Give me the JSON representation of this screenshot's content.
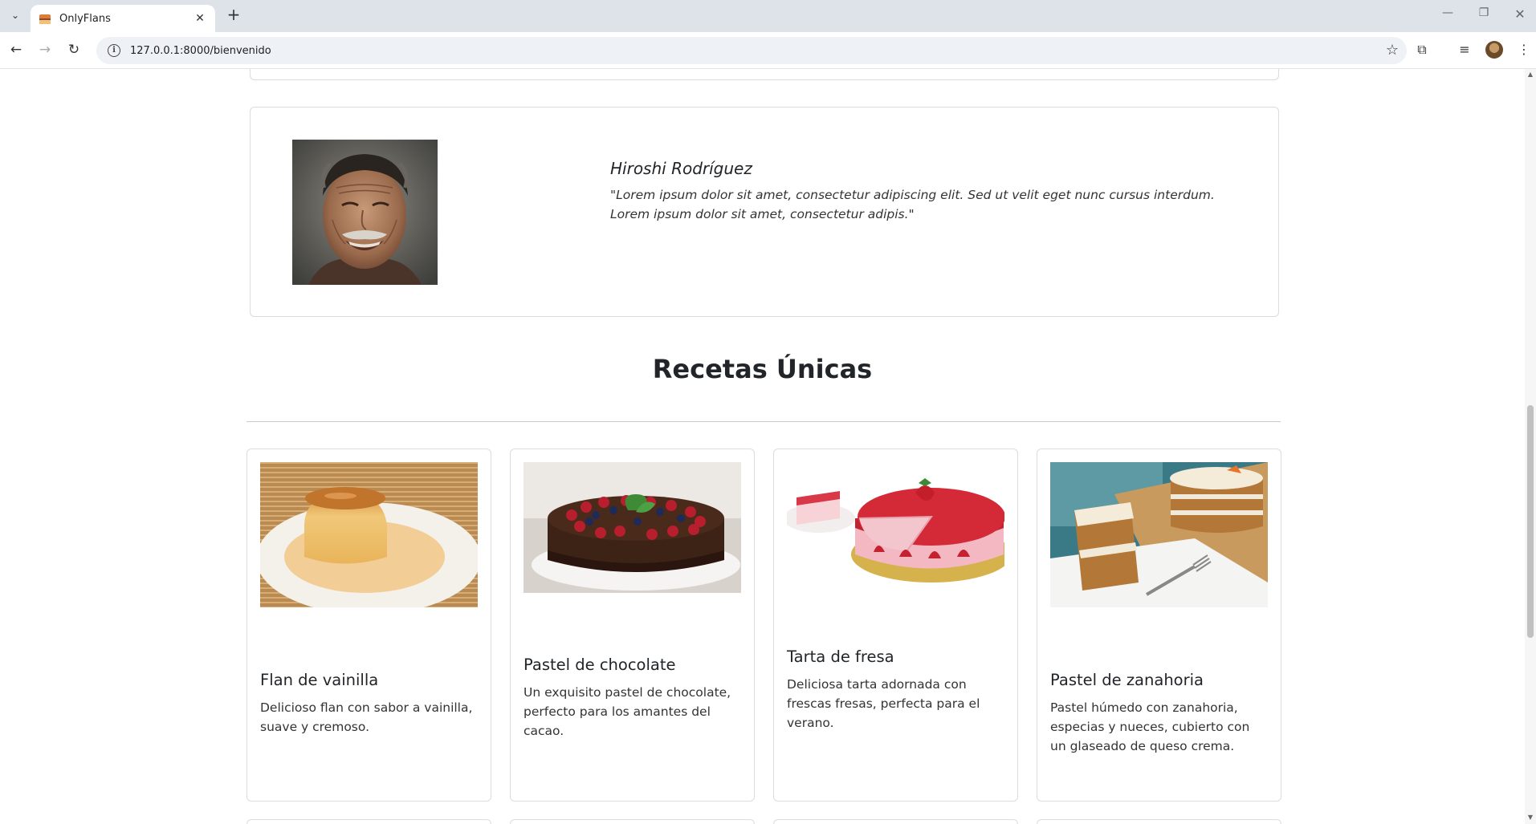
{
  "browser": {
    "tab_title": "OnlyFlans",
    "url": "127.0.0.1:8000/bienvenido"
  },
  "testimonial": {
    "name": "Hiroshi Rodríguez",
    "quote": "\"Lorem ipsum dolor sit amet, consectetur adipiscing elit. Sed ut velit eget nunc cursus interdum. Lorem ipsum dolor sit amet, consectetur adipis.\""
  },
  "section": {
    "title": "Recetas Únicas"
  },
  "recipes": [
    {
      "title": "Flan de vainilla",
      "description": "Delicioso flan con sabor a vainilla, suave y cremoso."
    },
    {
      "title": "Pastel de chocolate",
      "description": "Un exquisito pastel de chocolate, perfecto para los amantes del cacao."
    },
    {
      "title": "Tarta de fresa",
      "description": "Deliciosa tarta adornada con frescas fresas, perfecta para el verano."
    },
    {
      "title": "Pastel de zanahoria",
      "description": "Pastel húmedo con zanahoria, especias y nueces, cubierto con un glaseado de queso crema."
    }
  ]
}
